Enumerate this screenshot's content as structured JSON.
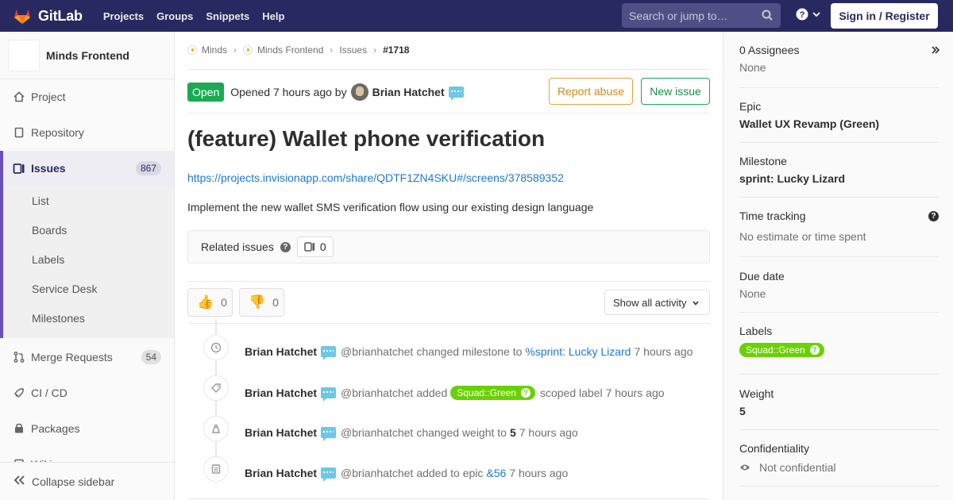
{
  "navbar": {
    "brand": "GitLab",
    "links": [
      "Projects",
      "Groups",
      "Snippets",
      "Help"
    ],
    "search_placeholder": "Search or jump to…",
    "signin": "Sign in / Register"
  },
  "sidebar": {
    "project_name": "Minds Frontend",
    "items": [
      {
        "label": "Project",
        "icon": "home-icon"
      },
      {
        "label": "Repository",
        "icon": "document-icon"
      },
      {
        "label": "Issues",
        "icon": "issues-icon",
        "count": "867"
      },
      {
        "label": "Merge Requests",
        "icon": "merge-request-icon",
        "count": "54"
      },
      {
        "label": "CI / CD",
        "icon": "rocket-icon"
      },
      {
        "label": "Packages",
        "icon": "package-icon"
      },
      {
        "label": "Wiki",
        "icon": "book-icon"
      }
    ],
    "subitems": [
      "List",
      "Boards",
      "Labels",
      "Service Desk",
      "Milestones"
    ],
    "collapse": "Collapse sidebar"
  },
  "breadcrumbs": [
    "Minds",
    "Minds Frontend",
    "Issues",
    "#1718"
  ],
  "issue": {
    "status": "Open",
    "opened_text": "Opened 7 hours ago by",
    "author": "Brian Hatchet",
    "report_abuse": "Report abuse",
    "new_issue": "New issue",
    "title": "(feature) Wallet phone verification",
    "link": "https://projects.invisionapp.com/share/QDTF1ZN4SKU#/screens/378589352",
    "description": "Implement the new wallet SMS verification flow using our existing design language",
    "related_title": "Related issues",
    "related_count": "0",
    "thumbs_up": "0",
    "thumbs_down": "0",
    "filter": "Show all activity"
  },
  "notes": [
    {
      "author": "Brian Hatchet",
      "handle": "@brianhatchet",
      "text": "changed milestone to",
      "link": "%sprint: Lucky Lizard",
      "time": "7 hours ago",
      "icon": "clock-icon"
    },
    {
      "author": "Brian Hatchet",
      "handle": "@brianhatchet",
      "text": "added",
      "label": "Squad::Green",
      "after": "scoped label",
      "time": "7 hours ago",
      "icon": "tag-icon"
    },
    {
      "author": "Brian Hatchet",
      "handle": "@brianhatchet",
      "text": "changed weight to",
      "bold": "5",
      "time": "7 hours ago",
      "icon": "weight-icon"
    },
    {
      "author": "Brian Hatchet",
      "handle": "@brianhatchet",
      "text": "added to epic",
      "link": "&56",
      "time": "7 hours ago",
      "icon": "epic-icon"
    }
  ],
  "right": {
    "assignees_title": "0 Assignees",
    "assignees_value": "None",
    "epic_title": "Epic",
    "epic_value": "Wallet UX Revamp (Green)",
    "milestone_title": "Milestone",
    "milestone_value": "sprint: Lucky Lizard",
    "time_title": "Time tracking",
    "time_value": "No estimate or time spent",
    "due_title": "Due date",
    "due_value": "None",
    "labels_title": "Labels",
    "label_value": "Squad::Green",
    "weight_title": "Weight",
    "weight_value": "5",
    "conf_title": "Confidentiality",
    "conf_value": "Not confidential"
  },
  "colors": {
    "navbar": "#292961",
    "accent": "#6b4fbb",
    "open": "#1aaa55",
    "link": "#1f78d1",
    "label": "#69d100"
  }
}
